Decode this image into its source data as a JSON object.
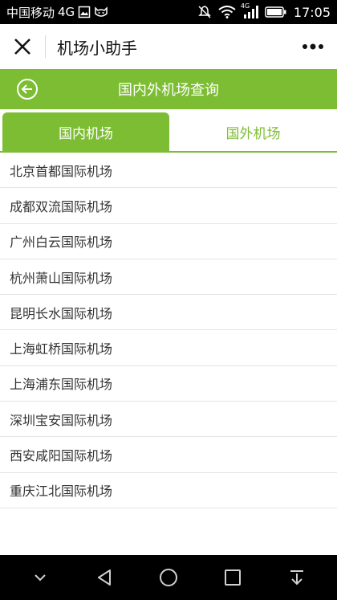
{
  "status_bar": {
    "carrier": "中国移动",
    "network": "4G",
    "signal_label": "4G",
    "time": "17:05"
  },
  "title_bar": {
    "title": "机场小助手"
  },
  "header": {
    "title": "国内外机场查询"
  },
  "tabs": [
    {
      "label": "国内机场",
      "active": true
    },
    {
      "label": "国外机场",
      "active": false
    }
  ],
  "airports": [
    "北京首都国际机场",
    "成都双流国际机场",
    "广州白云国际机场",
    "杭州萧山国际机场",
    "昆明长水国际机场",
    "上海虹桥国际机场",
    "上海浦东国际机场",
    "深圳宝安国际机场",
    "西安咸阳国际机场",
    "重庆江北国际机场"
  ],
  "colors": {
    "accent": "#7dbd33"
  }
}
